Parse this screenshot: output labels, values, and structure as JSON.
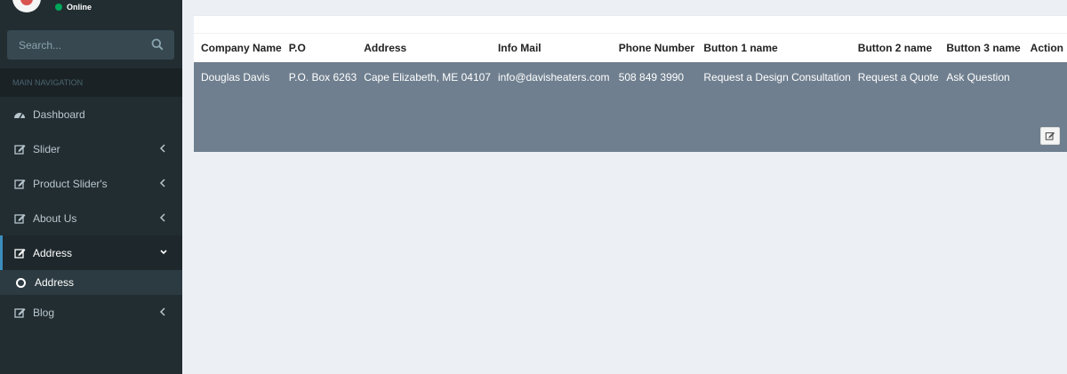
{
  "user": {
    "status": "Online"
  },
  "search": {
    "placeholder": "Search..."
  },
  "nav": {
    "header": "MAIN NAVIGATION",
    "items": [
      {
        "label": "Dashboard",
        "icon": "dashboard-icon"
      },
      {
        "label": "Slider",
        "icon": "edit-icon",
        "chevron": "chevron-left-icon"
      },
      {
        "label": "Product Slider's",
        "icon": "edit-icon",
        "chevron": "chevron-left-icon"
      },
      {
        "label": "About Us",
        "icon": "edit-icon",
        "chevron": "chevron-left-icon"
      },
      {
        "label": "Address",
        "icon": "edit-icon",
        "chevron": "chevron-down-icon",
        "active": true
      },
      {
        "label": "Blog",
        "icon": "edit-icon",
        "chevron": "chevron-left-icon"
      }
    ],
    "sub_item": {
      "label": "Address",
      "icon": "circle-icon"
    }
  },
  "table": {
    "columns": [
      "Company Name",
      "P.O",
      "Address",
      "Info Mail",
      "Phone Number",
      "Button 1 name",
      "Button 2 name",
      "Button 3 name",
      "Action"
    ],
    "rows": [
      [
        "Douglas Davis",
        "P.O. Box 6263",
        "Cape Elizabeth, ME 04107",
        "info@davisheaters.com",
        "508 849 3990",
        "Request a Design Consultation",
        "Request a Quote",
        "Ask Question",
        ""
      ]
    ]
  },
  "colors": {
    "sidebar_bg": "#222d32",
    "accent": "#3c8dbc",
    "online": "#00a65a",
    "row_highlight": "#6f7f8f",
    "page_bg": "#ecf0f5"
  }
}
